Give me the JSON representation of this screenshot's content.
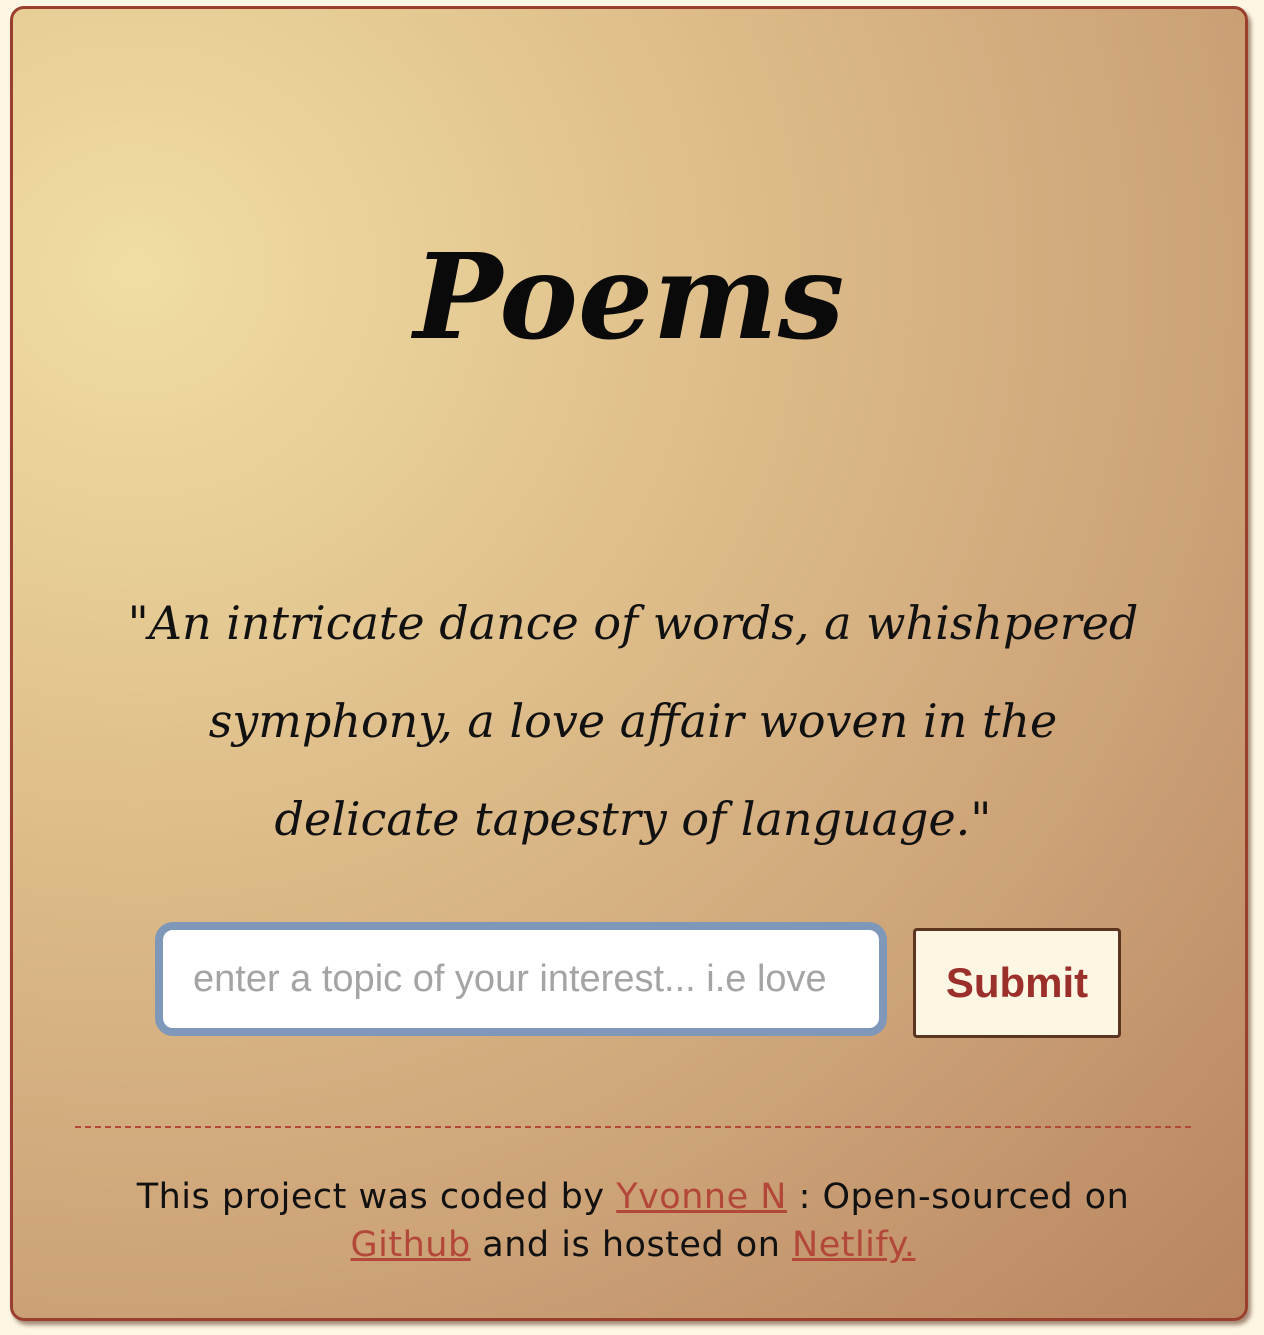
{
  "header": {
    "title": "Poems"
  },
  "main": {
    "quote": "\"An intricate dance of words, a whishpered symphony, a love affair woven in the delicate tapestry of language.\""
  },
  "search": {
    "placeholder": "enter a topic of your interest... i.e love",
    "value": "",
    "submit_label": "Submit"
  },
  "footer": {
    "text_1": "This project was coded by ",
    "author_link": "Yvonne N",
    "text_2": " : Open-sourced on ",
    "github_link": "Github",
    "text_3": " and is hosted on ",
    "netlify_link": "Netlify."
  },
  "colors": {
    "card_border": "#9a3f2e",
    "link": "#b3473a",
    "button_text": "#9b2f2a",
    "input_border": "#7f97b8",
    "button_bg": "#fdf6e3"
  }
}
